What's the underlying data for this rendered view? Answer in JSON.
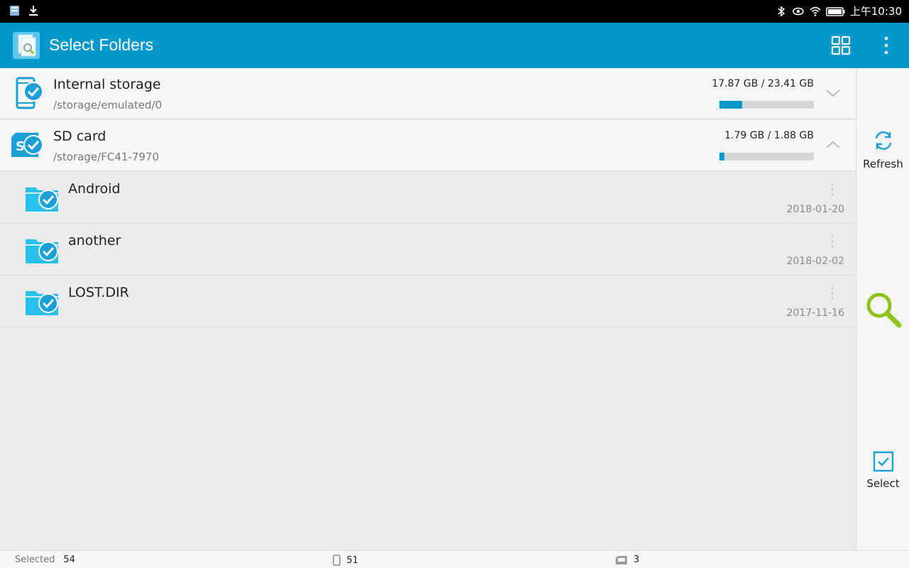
{
  "status_bar": {
    "left_icons": [
      "app-notification-icon",
      "download-icon"
    ],
    "right_icons": [
      "bluetooth-icon",
      "eye-icon",
      "wifi-icon",
      "battery-icon"
    ],
    "time": "上午10:30"
  },
  "app_bar": {
    "title": "Select Folders",
    "actions": [
      "grid-view-icon",
      "more-options-icon"
    ]
  },
  "storages": [
    {
      "name": "Internal storage",
      "path": "/storage/emulated/0",
      "size_text": "17.87 GB / 23.41 GB",
      "used_fraction": 0.24,
      "expanded": false
    },
    {
      "name": "SD card",
      "path": "/storage/FC41-7970",
      "size_text": "1.79 GB / 1.88 GB",
      "used_fraction": 0.05,
      "expanded": true
    }
  ],
  "folders": [
    {
      "name": "Android",
      "date": "2018-01-20"
    },
    {
      "name": "another",
      "date": "2018-02-02"
    },
    {
      "name": "LOST.DIR",
      "date": "2017-11-16"
    }
  ],
  "side_panel": {
    "refresh_label": "Refresh",
    "select_label": "Select"
  },
  "bottom_bar": {
    "selected_label": "Selected",
    "selected_count": "54",
    "phone_count": "51",
    "sd_count": "3"
  },
  "colors": {
    "accent": "#0399cc",
    "check": "#1a9fd6",
    "folder": "#29c0ea",
    "search": "#8dc21f"
  }
}
